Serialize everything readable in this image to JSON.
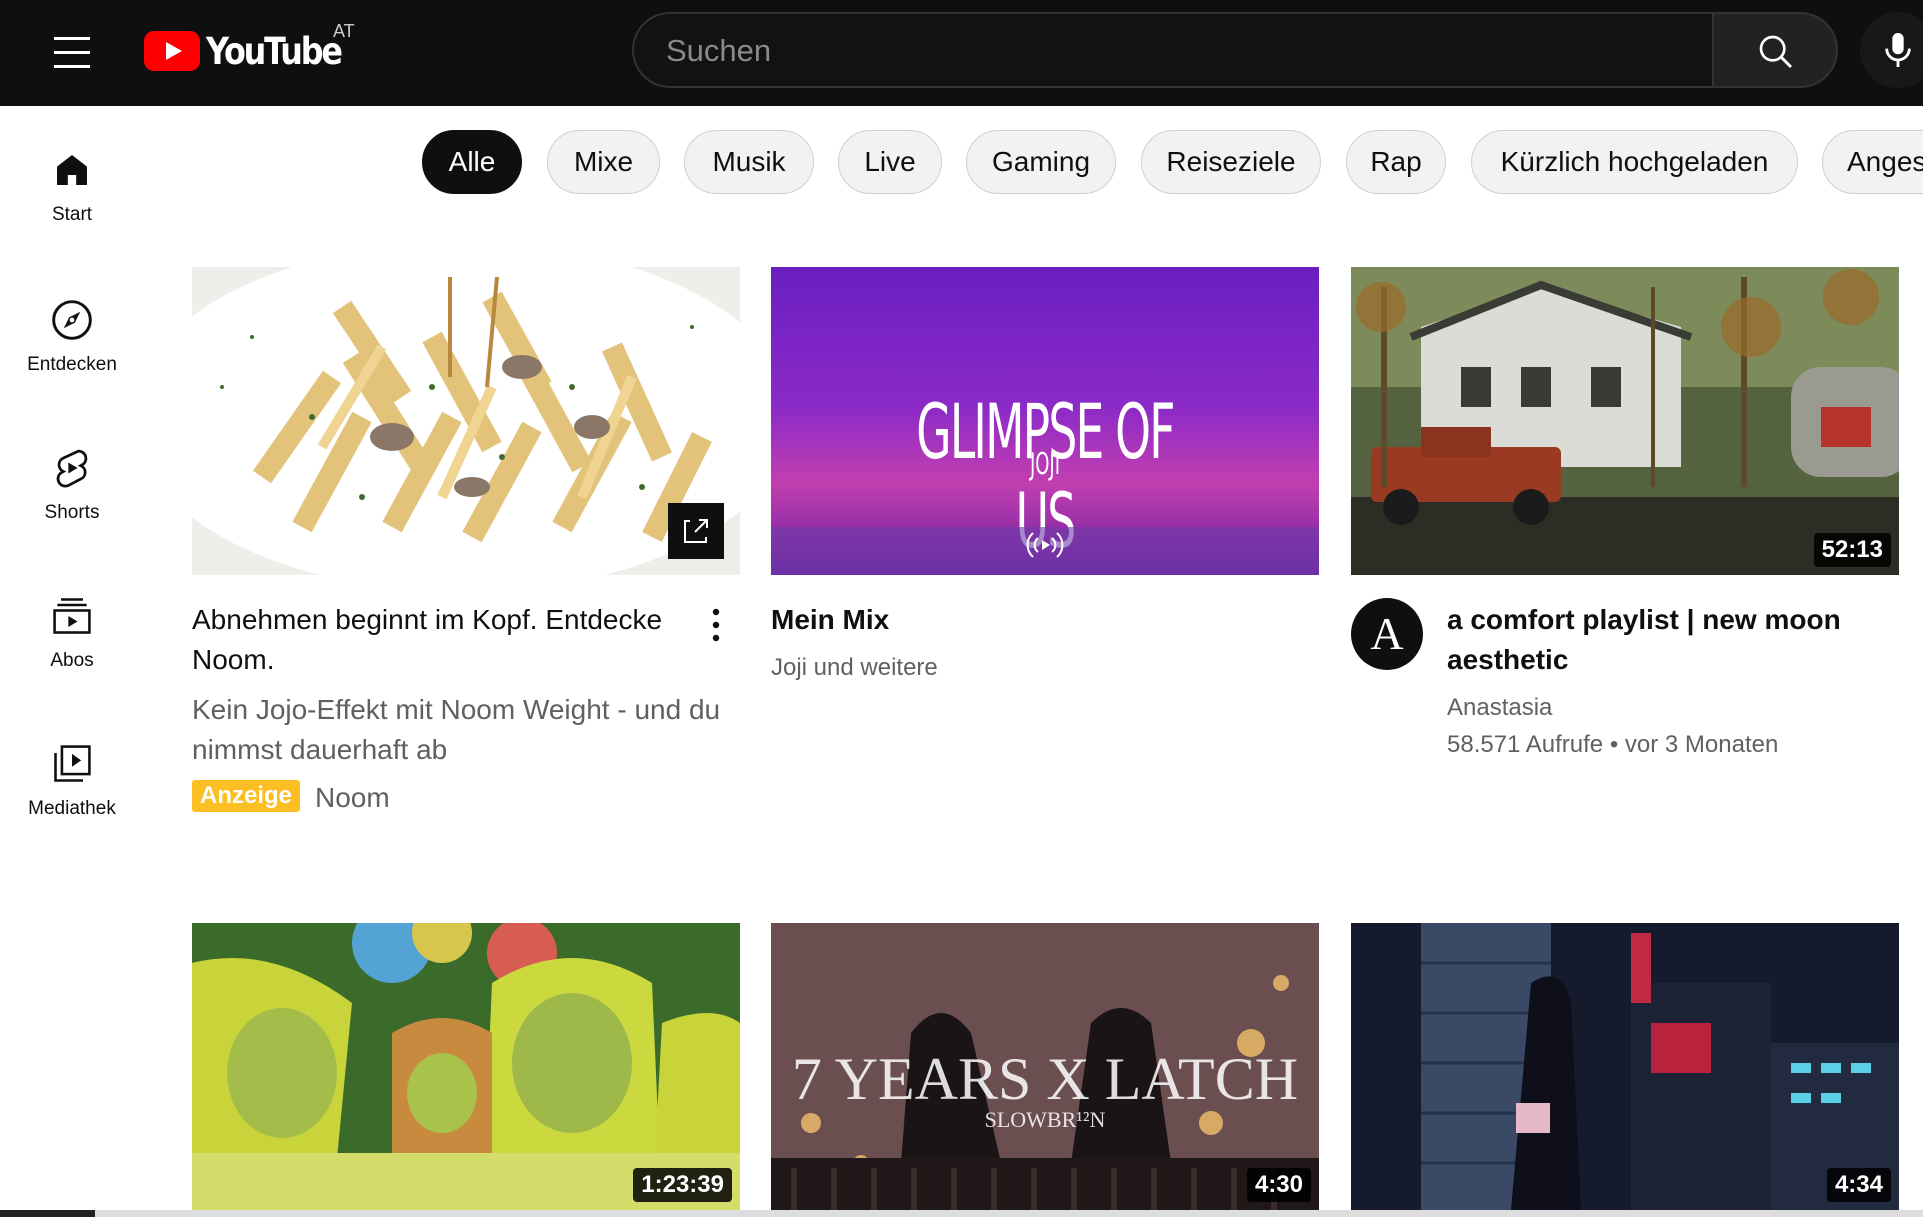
{
  "header": {
    "logo_text": "YouTube",
    "country_code": "AT",
    "search_placeholder": "Suchen"
  },
  "sidebar": {
    "items": [
      {
        "label": "Start",
        "icon": "home-icon"
      },
      {
        "label": "Entdecken",
        "icon": "compass-icon"
      },
      {
        "label": "Shorts",
        "icon": "shorts-icon"
      },
      {
        "label": "Abos",
        "icon": "subscriptions-icon"
      },
      {
        "label": "Mediathek",
        "icon": "library-icon"
      }
    ]
  },
  "chips": [
    "Alle",
    "Mixe",
    "Musik",
    "Live",
    "Gaming",
    "Reiseziele",
    "Rap",
    "Kürzlich hochgeladen",
    "Anges"
  ],
  "videos": [
    {
      "title_line1": "Abnehmen beginnt im Kopf. Entdecke",
      "title_line2": "Noom.",
      "desc_line1": "Kein Jojo-Effekt mit Noom Weight - und du",
      "desc_line2": "nimmst dauerhaft ab",
      "badge": "Anzeige",
      "advertiser": "Noom"
    },
    {
      "title": "Mein Mix",
      "thumb_title": "GLIMPSE OF US",
      "thumb_artist": "JOJI",
      "subtitle": "Joji und weitere"
    },
    {
      "title_line1": "a comfort playlist | new moon",
      "title_line2": "aesthetic",
      "channel": "Anastasia",
      "avatar_letter": "A",
      "views": "58.571 Aufrufe",
      "age": "vor 3 Monaten",
      "duration": "52:13"
    },
    {
      "duration": "1:23:39"
    },
    {
      "duration": "4:30",
      "thumb_title": "7 YEARS X LATCH",
      "thumb_sub": "SLOWBR¹²N"
    },
    {
      "duration": "4:34"
    }
  ],
  "colors": {
    "brand_red": "#ff0000",
    "ad_badge": "#fbbf24",
    "topbar_bg": "#0f0f0f"
  }
}
